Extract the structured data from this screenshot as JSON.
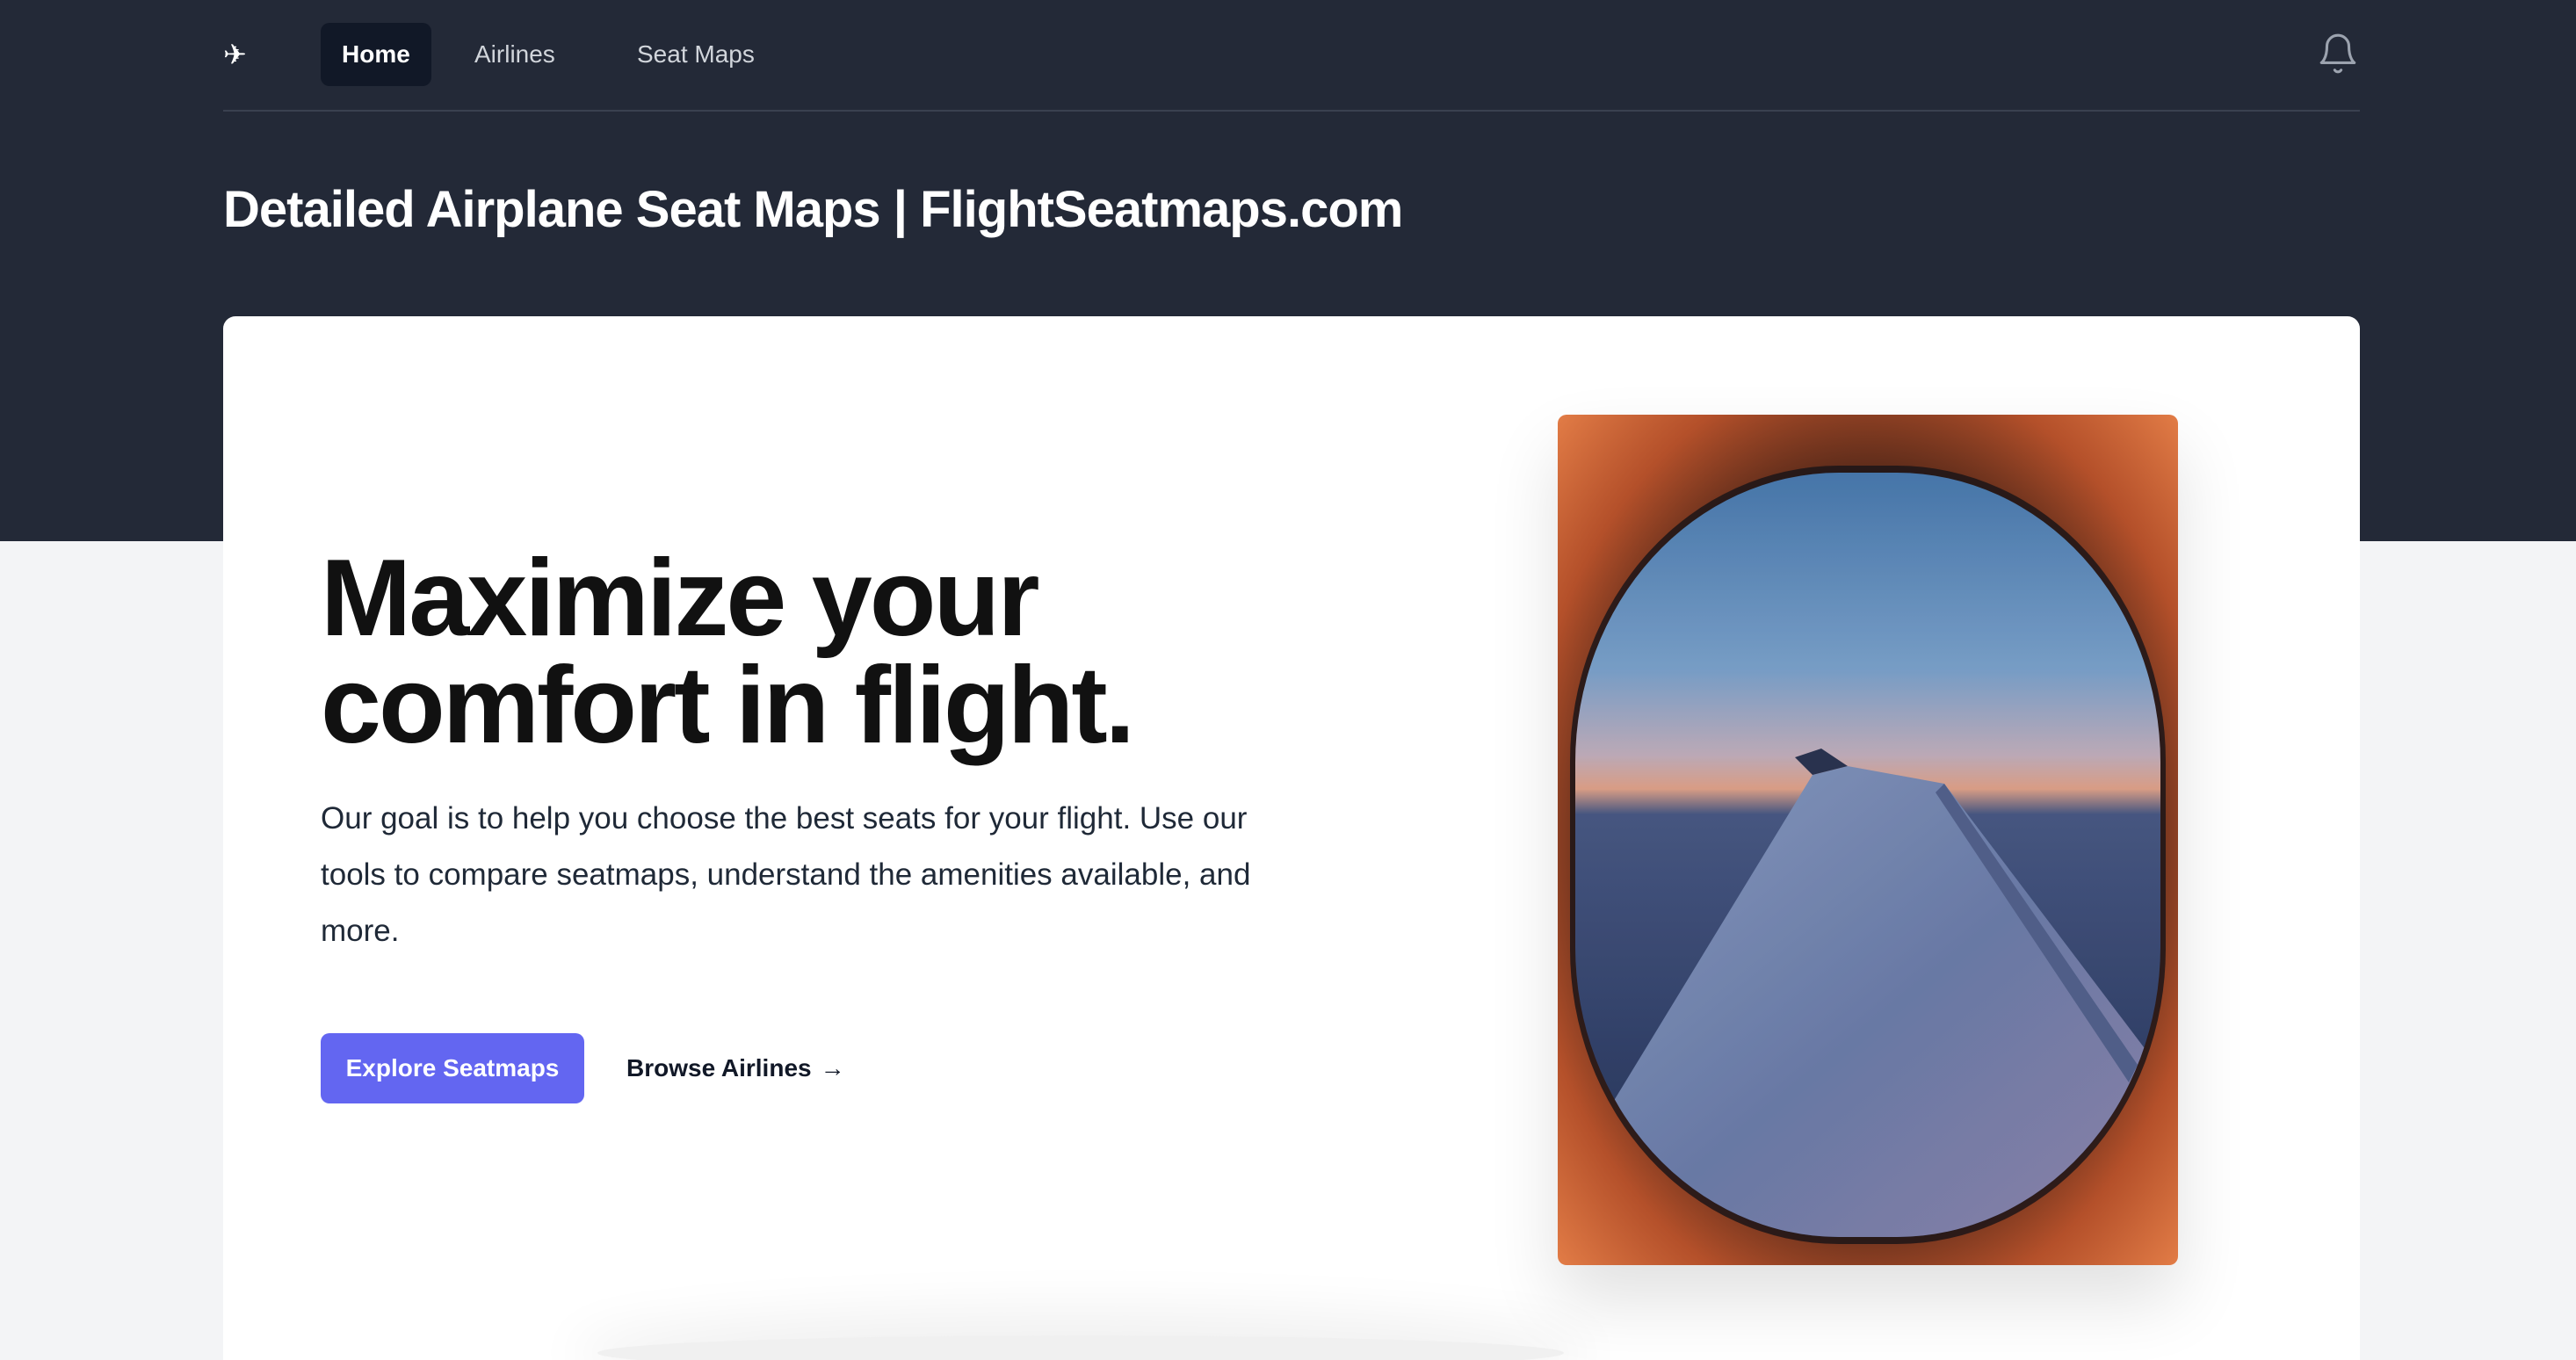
{
  "navbar": {
    "logo_icon": "airplane-icon",
    "items": [
      {
        "label": "Home",
        "active": true
      },
      {
        "label": "Airlines",
        "active": false
      },
      {
        "label": "Seat Maps",
        "active": false
      }
    ],
    "notification_icon": "bell-icon"
  },
  "page": {
    "title": "Detailed Airplane Seat Maps | FlightSeatmaps.com"
  },
  "hero": {
    "heading_line1": "Maximize your",
    "heading_line2": "comfort in flight.",
    "description": "Our goal is to help you choose the best seats for your flight. Use our tools to compare seatmaps, understand the amenities available, and more.",
    "primary_button": "Explore Seatmaps",
    "secondary_link": "Browse Airlines",
    "secondary_link_arrow": "→"
  },
  "colors": {
    "header_bg": "#232937",
    "accent": "#6366f1",
    "page_bg": "#f3f4f6"
  }
}
